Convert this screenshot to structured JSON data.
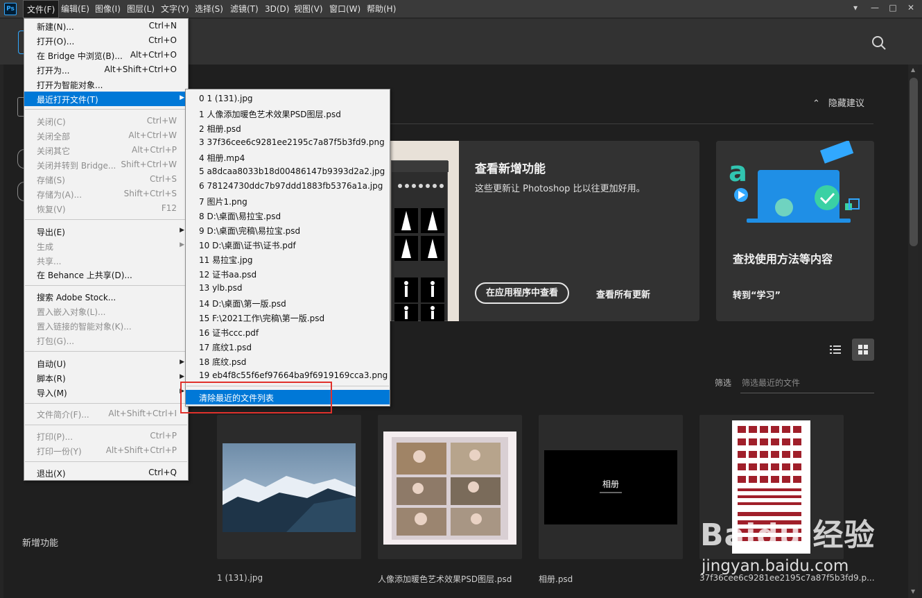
{
  "menubar": {
    "logo": "Ps",
    "items": [
      "文件(F)",
      "编辑(E)",
      "图像(I)",
      "图层(L)",
      "文字(Y)",
      "选择(S)",
      "滤镜(T)",
      "3D(D)",
      "视图(V)",
      "窗口(W)",
      "帮助(H)"
    ],
    "window_buttons": [
      "▾",
      "—",
      "□",
      "✕"
    ]
  },
  "file_menu": {
    "items": [
      {
        "label": "新建(N)...",
        "shortcut": "Ctrl+N"
      },
      {
        "label": "打开(O)...",
        "shortcut": "Ctrl+O"
      },
      {
        "label": "在 Bridge 中浏览(B)...",
        "shortcut": "Alt+Ctrl+O"
      },
      {
        "label": "打开为...",
        "shortcut": "Alt+Shift+Ctrl+O"
      },
      {
        "label": "打开为智能对象...",
        "shortcut": ""
      },
      {
        "label": "最近打开文件(T)",
        "shortcut": ""
      },
      {
        "label": "关闭(C)",
        "shortcut": "Ctrl+W"
      },
      {
        "label": "关闭全部",
        "shortcut": "Alt+Ctrl+W"
      },
      {
        "label": "关闭其它",
        "shortcut": "Alt+Ctrl+P"
      },
      {
        "label": "关闭并转到 Bridge...",
        "shortcut": "Shift+Ctrl+W"
      },
      {
        "label": "存储(S)",
        "shortcut": "Ctrl+S"
      },
      {
        "label": "存储为(A)...",
        "shortcut": "Shift+Ctrl+S"
      },
      {
        "label": "恢复(V)",
        "shortcut": "F12"
      },
      {
        "label": "导出(E)",
        "shortcut": ""
      },
      {
        "label": "生成",
        "shortcut": ""
      },
      {
        "label": "共享...",
        "shortcut": ""
      },
      {
        "label": "在 Behance 上共享(D)...",
        "shortcut": ""
      },
      {
        "label": "搜索 Adobe Stock...",
        "shortcut": ""
      },
      {
        "label": "置入嵌入对象(L)...",
        "shortcut": ""
      },
      {
        "label": "置入链接的智能对象(K)...",
        "shortcut": ""
      },
      {
        "label": "打包(G)...",
        "shortcut": ""
      },
      {
        "label": "自动(U)",
        "shortcut": ""
      },
      {
        "label": "脚本(R)",
        "shortcut": ""
      },
      {
        "label": "导入(M)",
        "shortcut": ""
      },
      {
        "label": "文件简介(F)...",
        "shortcut": "Alt+Shift+Ctrl+I"
      },
      {
        "label": "打印(P)...",
        "shortcut": "Ctrl+P"
      },
      {
        "label": "打印一份(Y)",
        "shortcut": "Alt+Shift+Ctrl+P"
      },
      {
        "label": "退出(X)",
        "shortcut": "Ctrl+Q"
      }
    ]
  },
  "recent_menu": {
    "items": [
      "0  1 (131).jpg",
      "1  人像添加暖色艺术效果PSD图层.psd",
      "2  相册.psd",
      "3  37f36cee6c9281ee2195c7a87f5b3fd9.png",
      "4  相册.mp4",
      "5  a8dcaa8033b18d00486147b9393d2a2.jpg",
      "6  78124730ddc7b97ddd1883fb5376a1a.jpg",
      "7  图片1.png",
      "8  D:\\桌面\\易拉宝.psd",
      "9  D:\\桌面\\完稿\\易拉宝.psd",
      "10  D:\\桌面\\证书\\证书.pdf",
      "11  易拉宝.jpg",
      "12  证书aa.psd",
      "13  ylb.psd",
      "14  D:\\桌面\\第一版.psd",
      "15  F:\\2021工作\\完稿\\第一版.psd",
      "16  证书ccc.pdf",
      "17  底纹1.psd",
      "18  底纹.psd",
      "19  eb4f8c55f6ef97664ba9f6919169cca3.png"
    ],
    "clear_label": "清除最近的文件列表"
  },
  "home": {
    "hide_suggestions": "隐藏建议",
    "card_new": {
      "title": "查看新增功能",
      "desc": "这些更新让 Photoshop 比以往更加好用。",
      "btn_view_in_app": "在应用程序中查看",
      "link_view_all": "查看所有更新"
    },
    "card_learn": {
      "title": "查找使用方法等内容",
      "link": "转到“学习”"
    },
    "filter_label": "筛选",
    "filter_placeholder": "筛选最近的文件",
    "new_features_nav": "新增功能",
    "recent_files": [
      {
        "name": "1 (131).jpg"
      },
      {
        "name": "人像添加暖色艺术效果PSD图层.psd"
      },
      {
        "name": "相册.psd",
        "thumb_text": "相册"
      },
      {
        "name": "37f36cee6c9281ee2195c7a87f5b3fd9.p..."
      }
    ]
  },
  "watermark": {
    "big": "Baidu 经验",
    "small": "jingyan.baidu.com"
  },
  "colors": {
    "accent": "#31a8ff",
    "highlight": "#0078d7",
    "annotation": "#e0312b"
  }
}
